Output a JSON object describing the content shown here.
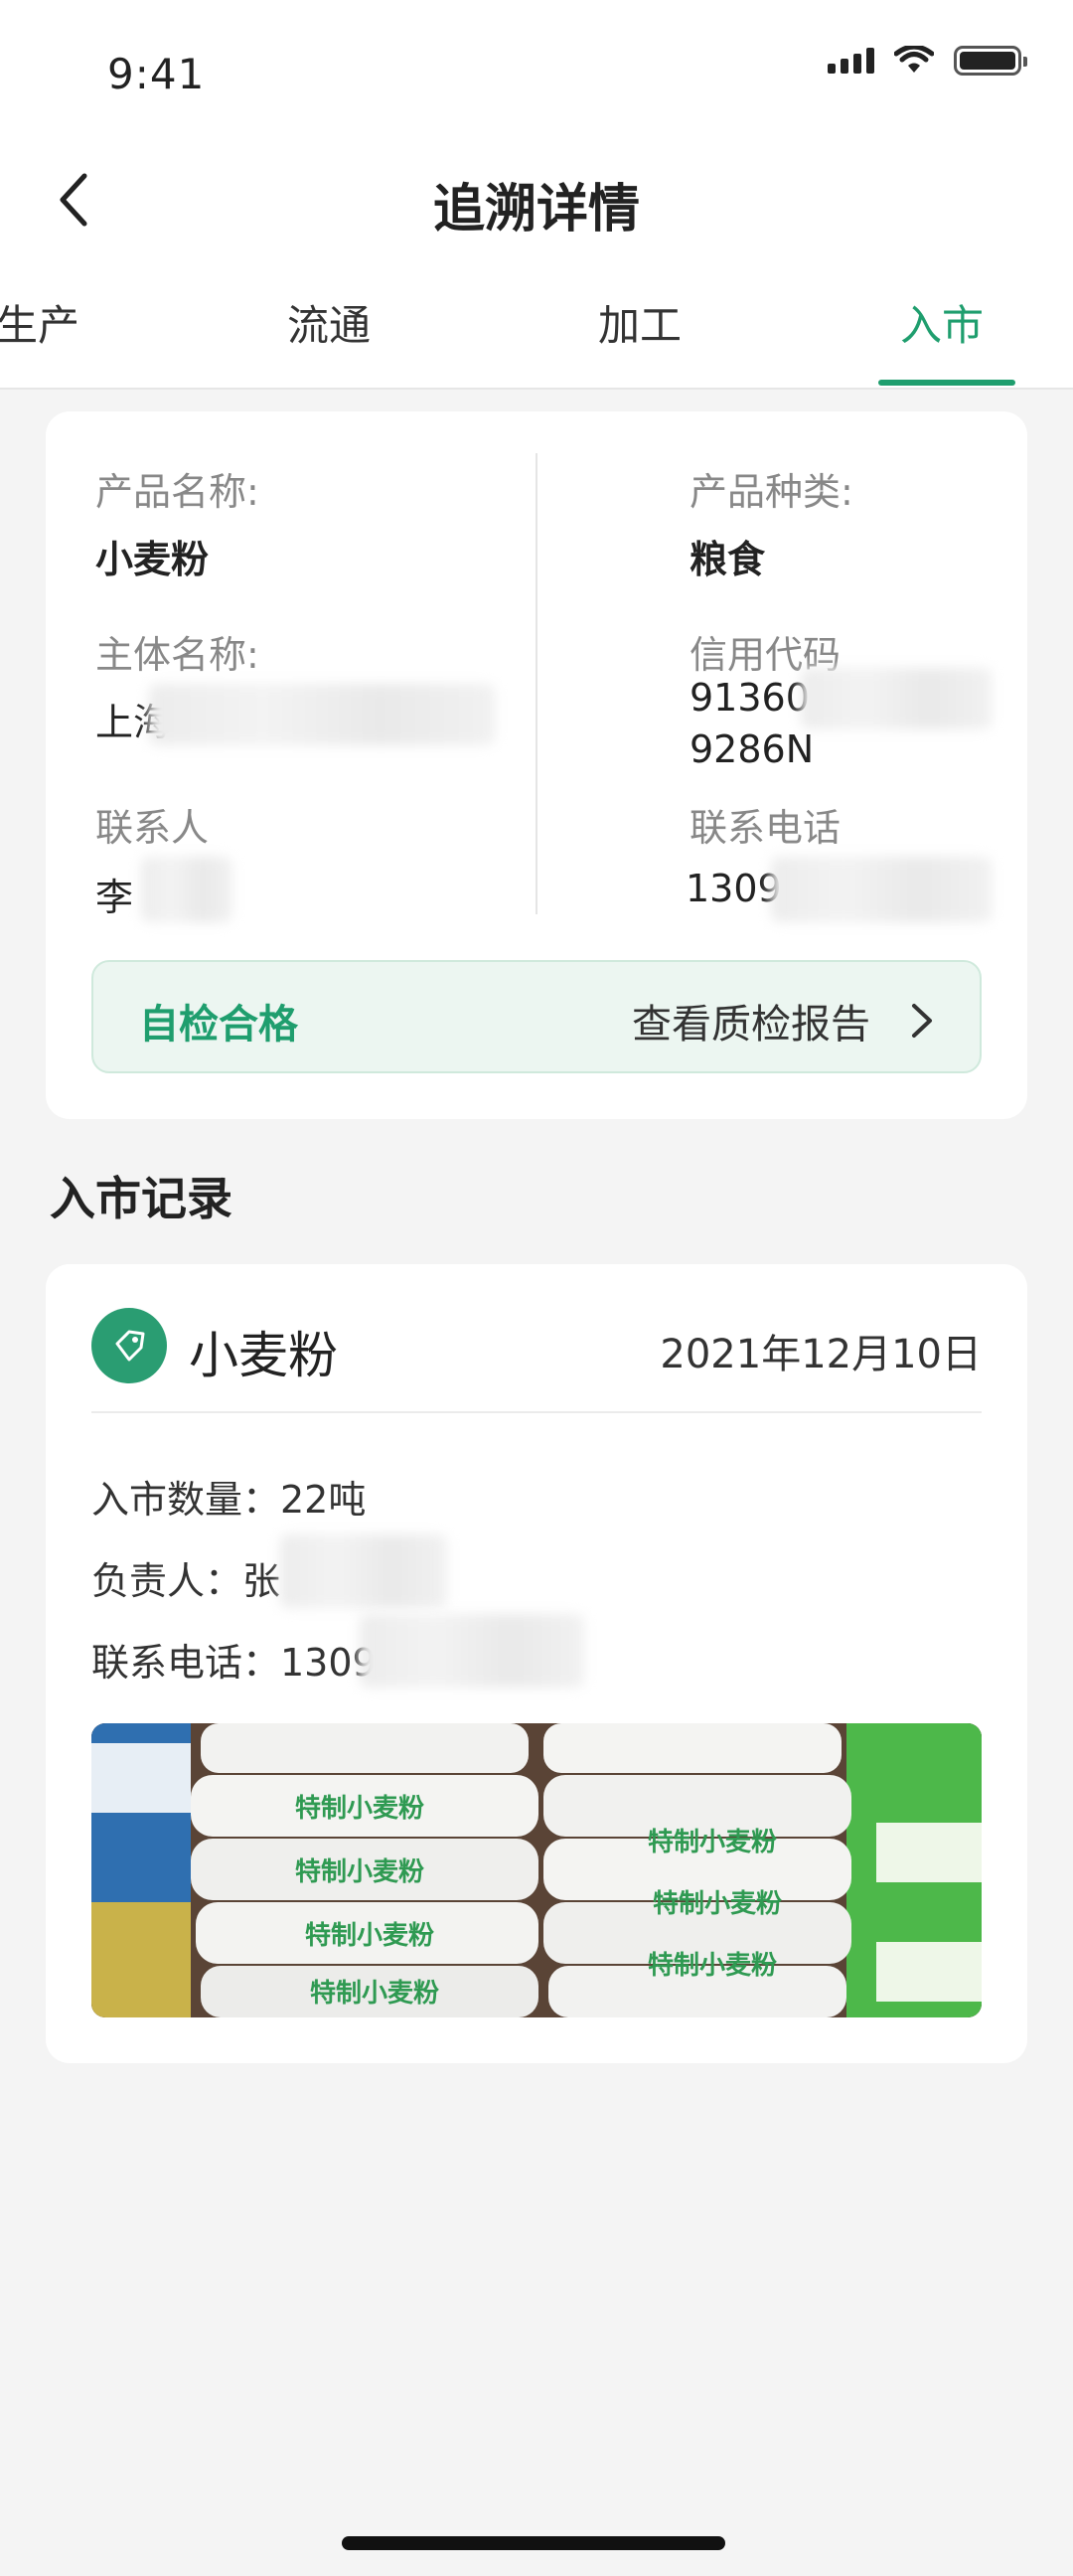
{
  "status": {
    "time": "9:41"
  },
  "nav": {
    "title": "追溯详情"
  },
  "tabs": [
    {
      "label": "生产"
    },
    {
      "label": "流通"
    },
    {
      "label": "加工"
    },
    {
      "label": "入市",
      "active": true
    }
  ],
  "info": {
    "product_name_label": "产品名称:",
    "product_name": "小麦粉",
    "product_type_label": "产品种类:",
    "product_type": "粮食",
    "entity_label": "主体名称:",
    "entity_value": "上海",
    "credit_label": "信用代码",
    "credit_line1": "91360",
    "credit_line2": "9286N",
    "contact_label": "联系人",
    "contact_value": "李",
    "phone_label": "联系电话",
    "phone_value": "1309",
    "check_status": "自检合格",
    "check_link": "查看质检报告"
  },
  "records_title": "入市记录",
  "record": {
    "name": "小麦粉",
    "date": "2021年12月10日",
    "quantity_line": "入市数量：22吨",
    "person_line": "负责人：张",
    "phone_line": "联系电话：1309"
  },
  "photo": {
    "bag_label": "特制小麦粉"
  },
  "colors": {
    "accent": "#1f9e6e",
    "background": "#f4f4f4"
  }
}
